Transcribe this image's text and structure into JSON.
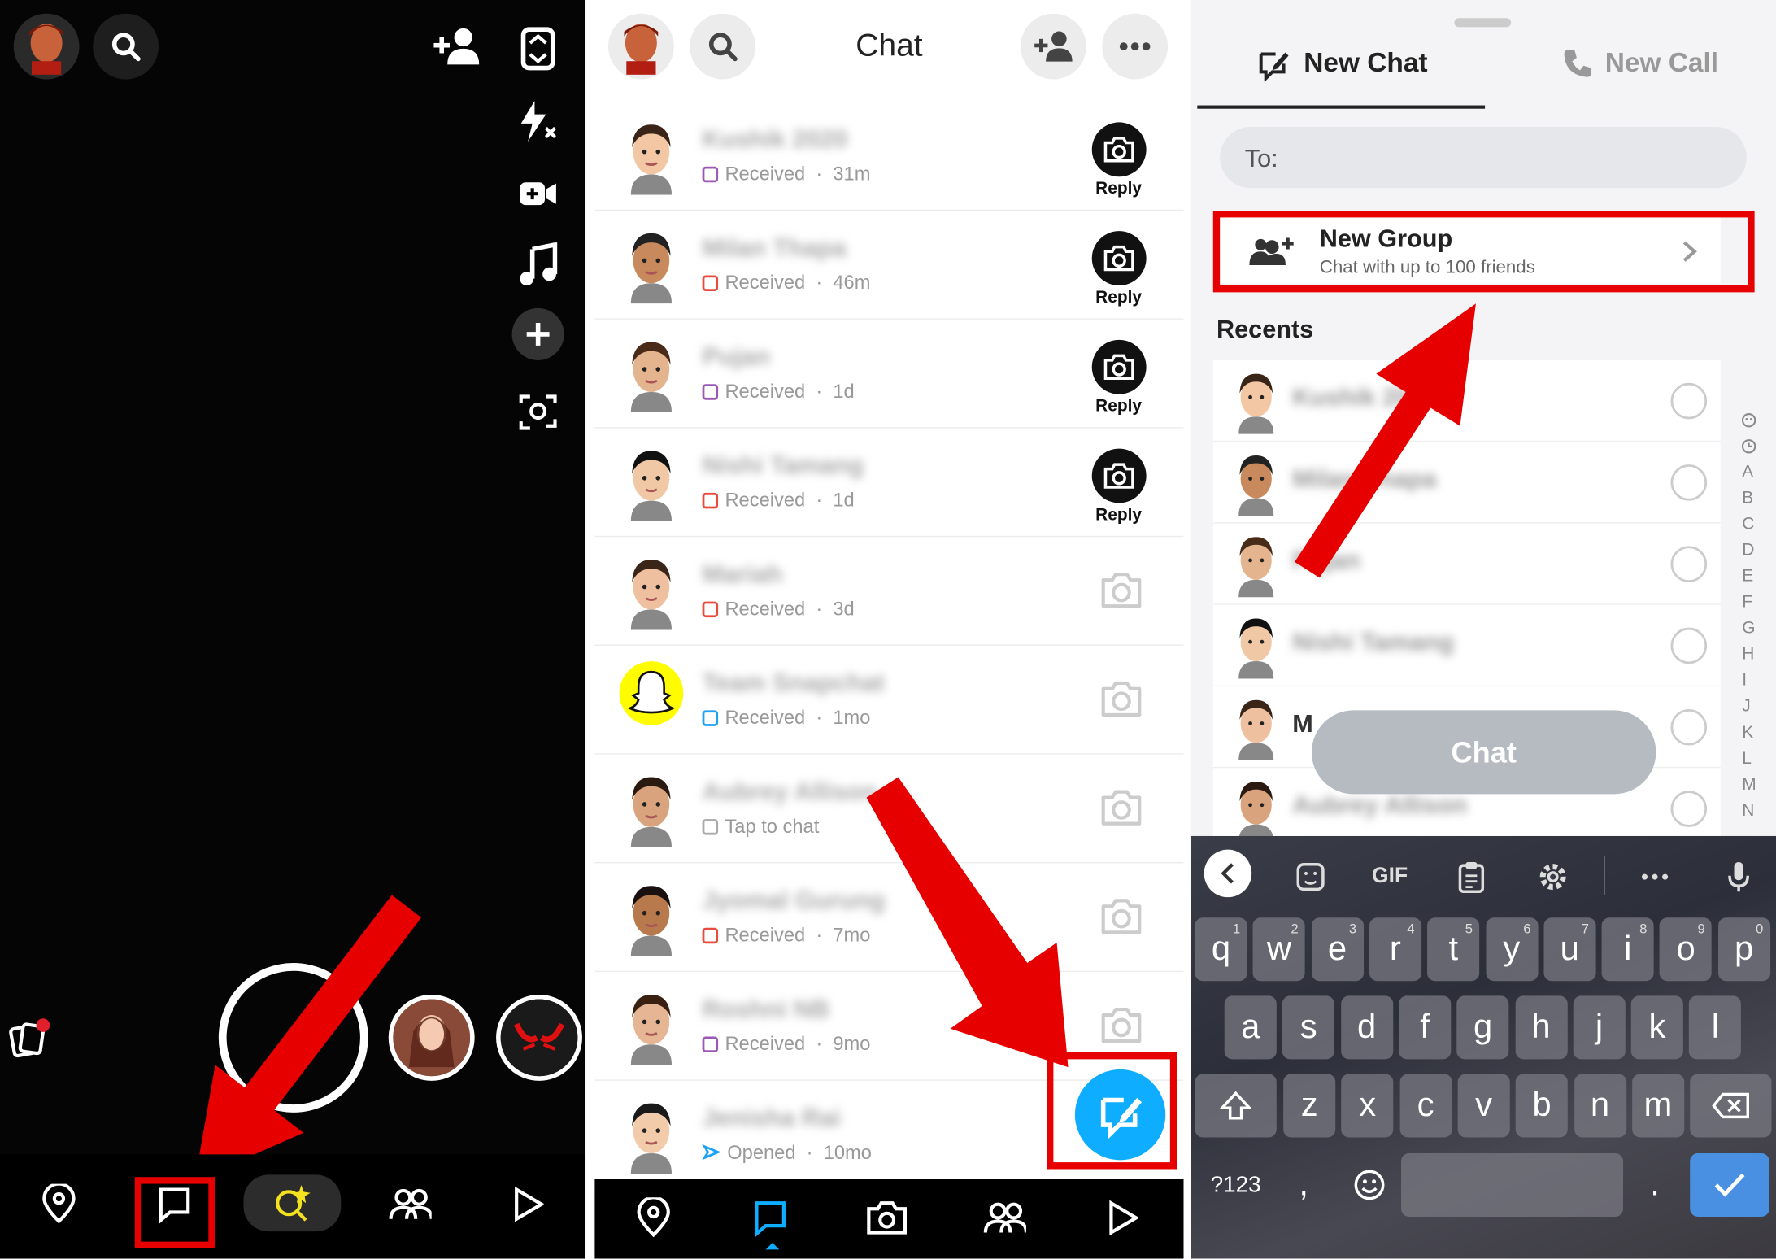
{
  "panel1": {
    "nav": [
      "map",
      "chat",
      "spotlight",
      "friends",
      "stories"
    ]
  },
  "panel2": {
    "title": "Chat",
    "chats": [
      {
        "name": "Kushik 2020",
        "status": "Received",
        "time": "31m",
        "action": "Reply",
        "sq": "#9b59b6"
      },
      {
        "name": "Milan Thapa",
        "status": "Received",
        "time": "46m",
        "action": "Reply",
        "sq": "#e74c3c"
      },
      {
        "name": "Pujan",
        "status": "Received",
        "time": "1d",
        "action": "Reply",
        "sq": "#9b59b6"
      },
      {
        "name": "Nishi Tamang",
        "status": "Received",
        "time": "1d",
        "action": "Reply",
        "sq": "#e74c3c"
      },
      {
        "name": "Mariah",
        "status": "Received",
        "time": "3d",
        "action": "",
        "sq": "#e74c3c"
      },
      {
        "name": "Team Snapchat",
        "status": "Received",
        "time": "1mo",
        "action": "",
        "sq": "#1da1f2"
      },
      {
        "name": "Aubrey Allison",
        "status": "Tap to chat",
        "time": "",
        "action": "",
        "sq": "#aaaaaa"
      },
      {
        "name": "Jyomal Gurung",
        "status": "Received",
        "time": "7mo",
        "action": "",
        "sq": "#e74c3c"
      },
      {
        "name": "Roshni NB",
        "status": "Received",
        "time": "9mo",
        "action": "",
        "sq": "#9b59b6"
      },
      {
        "name": "Jenisha Rai",
        "status": "Opened",
        "time": "10mo",
        "action": "",
        "sq": "#1da1f2"
      }
    ]
  },
  "panel3": {
    "tab_chat": "New Chat",
    "tab_call": "New Call",
    "to_label": "To:",
    "new_group_title": "New Group",
    "new_group_sub": "Chat with up to 100 friends",
    "recents_label": "Recents",
    "recents": [
      "Kushik 2020",
      "Milan Thapa",
      "Pujan",
      "Nishi Tamang",
      "M",
      "Aubrey Allison"
    ],
    "chat_button": "Chat",
    "alphabet": [
      "A",
      "B",
      "C",
      "D",
      "E",
      "F",
      "G",
      "H",
      "I",
      "J",
      "K",
      "L",
      "M",
      "N"
    ],
    "keyboard": {
      "row1": [
        [
          "q",
          "1"
        ],
        [
          "w",
          "2"
        ],
        [
          "e",
          "3"
        ],
        [
          "r",
          "4"
        ],
        [
          "t",
          "5"
        ],
        [
          "y",
          "6"
        ],
        [
          "u",
          "7"
        ],
        [
          "i",
          "8"
        ],
        [
          "o",
          "9"
        ],
        [
          "p",
          "0"
        ]
      ],
      "row2": [
        "a",
        "s",
        "d",
        "f",
        "g",
        "h",
        "j",
        "k",
        "l"
      ],
      "row3": [
        "z",
        "x",
        "c",
        "v",
        "b",
        "n",
        "m"
      ],
      "sym": "?123",
      "comma": ",",
      "period": ".",
      "gif": "GIF"
    }
  },
  "colors": {
    "accent_blue": "#0eadff",
    "highlight_red": "#e60000",
    "snap_yellow": "#fffc00"
  }
}
